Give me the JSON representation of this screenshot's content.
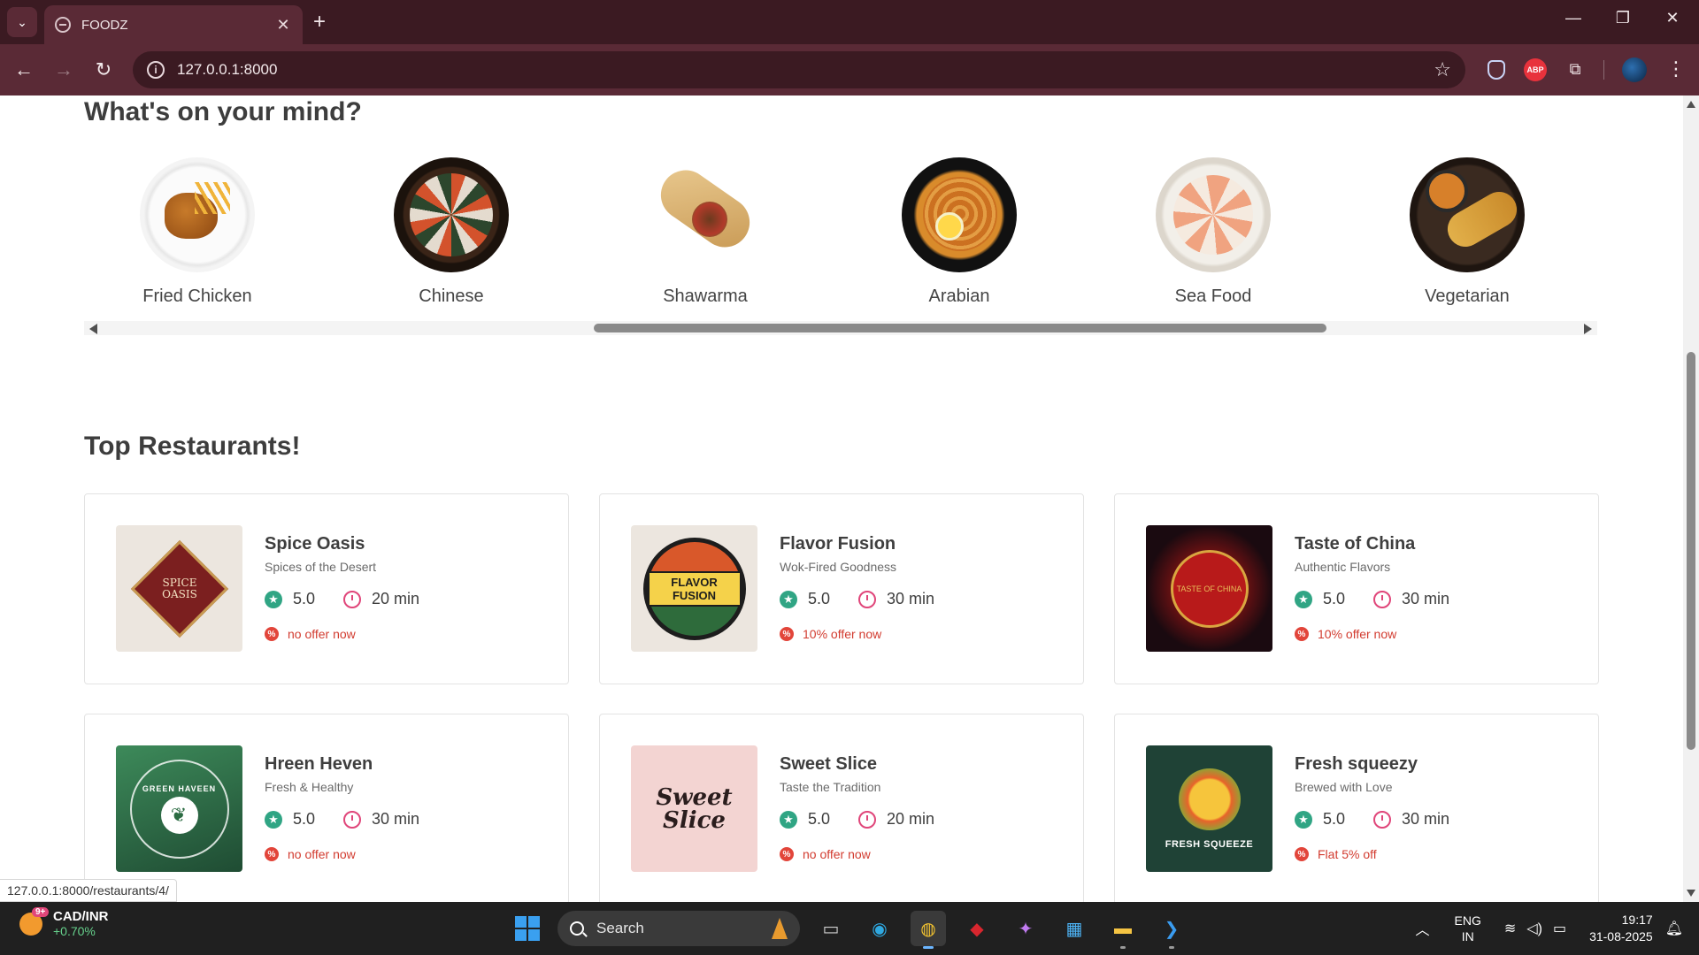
{
  "browser": {
    "tab_title": "FOODZ",
    "tab_close": "✕",
    "new_tab": "+",
    "url": "127.0.0.1:8000",
    "window_controls": {
      "minimize": "—",
      "restore": "❐",
      "close": "✕"
    },
    "extension_abp": "ABP"
  },
  "categories_section": {
    "title": "What's on your mind?",
    "items": [
      {
        "label": "Fried Chicken",
        "icon": "fried-chicken-image"
      },
      {
        "label": "Chinese",
        "icon": "sushi-platter-image"
      },
      {
        "label": "Shawarma",
        "icon": "shawarma-wrap-image"
      },
      {
        "label": "Arabian",
        "icon": "arabian-rice-image"
      },
      {
        "label": "Sea Food",
        "icon": "seafood-platter-image"
      },
      {
        "label": "Vegetarian",
        "icon": "vegetarian-thali-image"
      }
    ]
  },
  "restaurants_section": {
    "title": "Top Restaurants!",
    "cards": [
      {
        "name": "Spice Oasis",
        "tagline": "Spices of the Desert",
        "rating": "5.0",
        "time": "20 min",
        "offer": "no offer now",
        "logo_text": "SPICE OASIS"
      },
      {
        "name": "Flavor Fusion",
        "tagline": "Wok-Fired Goodness",
        "rating": "5.0",
        "time": "30 min",
        "offer": "10% offer now",
        "logo_text": "FLAVOR FUSION"
      },
      {
        "name": "Taste of China",
        "tagline": "Authentic Flavors",
        "rating": "5.0",
        "time": "30 min",
        "offer": "10% offer now",
        "logo_text": "TASTE OF CHINA"
      },
      {
        "name": "Hreen Heven",
        "tagline": "Fresh & Healthy",
        "rating": "5.0",
        "time": "30 min",
        "offer": "no offer now",
        "logo_text": "GREEN HAVEEN"
      },
      {
        "name": "Sweet Slice",
        "tagline": "Taste the Tradition",
        "rating": "5.0",
        "time": "20 min",
        "offer": "no offer now",
        "logo_text": "Sweet Slice"
      },
      {
        "name": "Fresh squeezy",
        "tagline": "Brewed with Love",
        "rating": "5.0",
        "time": "30 min",
        "offer": "Flat 5% off",
        "logo_text": "FRESH SQUEEZE"
      }
    ]
  },
  "status_bar_link": "127.0.0.1:8000/restaurants/4/",
  "taskbar": {
    "weather_badge": "9+",
    "ticker": "CAD/INR",
    "ticker_change": "+0.70%",
    "search_placeholder": "Search",
    "lang_line1": "ENG",
    "lang_line2": "IN",
    "time": "19:17",
    "date": "31-08-2025"
  },
  "colors": {
    "accent_rating": "#30a584",
    "accent_clock": "#e0467a",
    "accent_offer": "#d23b2f",
    "chrome_dark": "#3b1a22",
    "chrome_toolbar": "#5a2a36"
  }
}
